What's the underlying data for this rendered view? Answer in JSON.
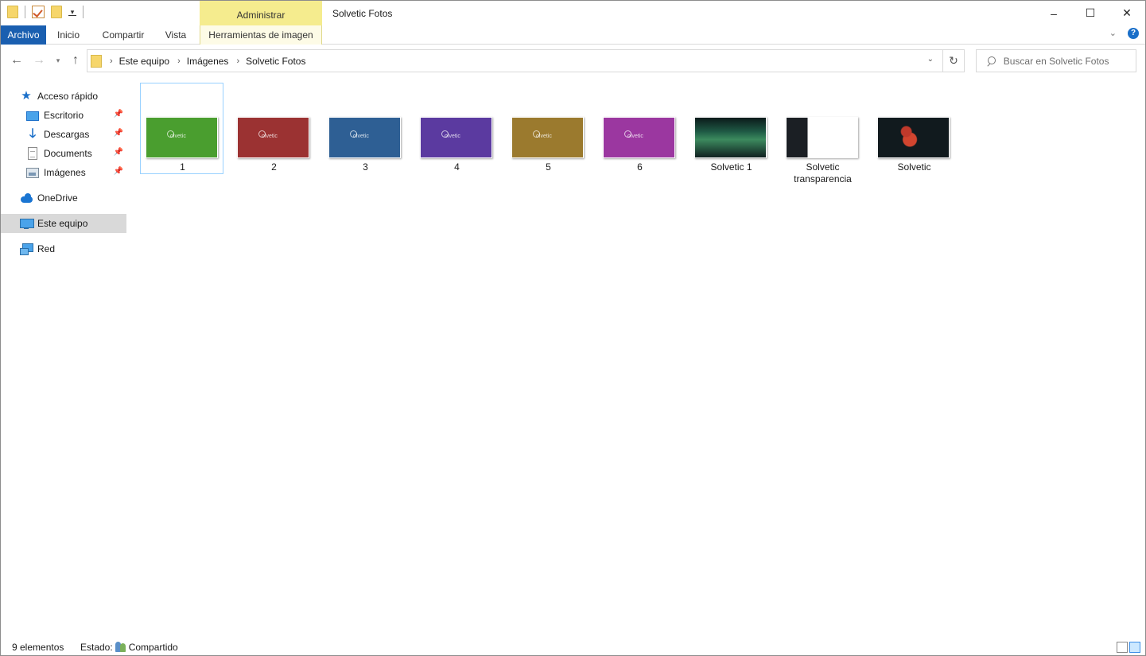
{
  "window": {
    "title": "Solvetic Fotos",
    "contextual_group": "Administrar",
    "controls": [
      "–",
      "☐",
      "✕"
    ]
  },
  "ribbon": {
    "tabs": [
      "Archivo",
      "Inicio",
      "Compartir",
      "Vista",
      "Herramientas de imagen"
    ],
    "active_color": "#1a5fb0",
    "contextual_color": "#f5ec8e"
  },
  "address": {
    "crumbs": [
      "Este equipo",
      "Imágenes",
      "Solvetic Fotos"
    ]
  },
  "search": {
    "placeholder": "Buscar en Solvetic Fotos"
  },
  "sidebar": {
    "items": [
      {
        "label": "Acceso rápido",
        "icon": "star-icon"
      },
      {
        "label": "Escritorio",
        "icon": "desktop-icon",
        "pinned": true
      },
      {
        "label": "Descargas",
        "icon": "download-icon",
        "pinned": true
      },
      {
        "label": "Documents",
        "icon": "document-icon",
        "pinned": true
      },
      {
        "label": "Imágenes",
        "icon": "pictures-icon",
        "pinned": true
      },
      {
        "label": "OneDrive",
        "icon": "cloud-icon"
      },
      {
        "label": "Este equipo",
        "icon": "computer-icon",
        "selected": true
      },
      {
        "label": "Red",
        "icon": "network-icon"
      }
    ]
  },
  "files": [
    {
      "name": "1",
      "color": "#4a9e2f",
      "selected": true
    },
    {
      "name": "2",
      "color": "#9b3232"
    },
    {
      "name": "3",
      "color": "#2e5f94"
    },
    {
      "name": "4",
      "color": "#5b3aa0"
    },
    {
      "name": "5",
      "color": "#9b7a2e"
    },
    {
      "name": "6",
      "color": "#9b37a0"
    },
    {
      "name": "Solvetic 1",
      "color": "aurora"
    },
    {
      "name": "Solvetic transparencia",
      "color": "transparent"
    },
    {
      "name": "Solvetic",
      "color": "ibis"
    }
  ],
  "thumb_watermark": "olvetic",
  "status": {
    "count": "9 elementos",
    "state_label": "Estado:",
    "state_value": "Compartido"
  }
}
